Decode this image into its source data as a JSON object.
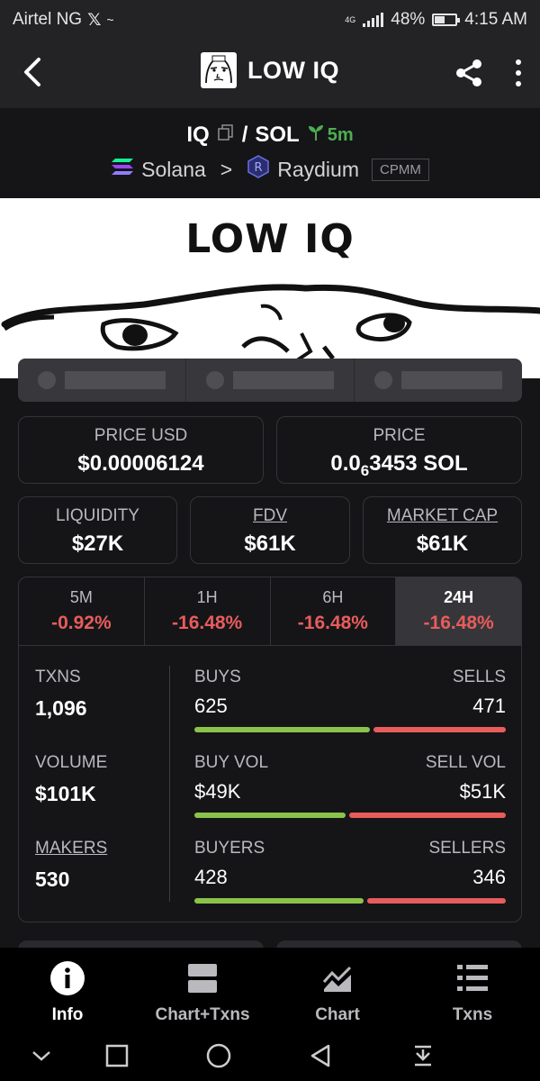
{
  "status_bar": {
    "carrier": "Airtel NG",
    "network": "4G",
    "battery": "48%",
    "time": "4:15 AM"
  },
  "app_bar": {
    "title": "LOW IQ",
    "icons": [
      "back-arrow-icon",
      "share-icon",
      "more-vertical-icon"
    ]
  },
  "pair": {
    "base": "IQ",
    "separator": "/",
    "quote": "SOL",
    "age": "5m",
    "chain": "Solana",
    "chevron": ">",
    "dex": "Raydium",
    "pool_type": "CPMM"
  },
  "banner": {
    "title": "LOW IQ"
  },
  "prices": {
    "price_usd_label": "PRICE USD",
    "price_usd": "$0.00006124",
    "price_label": "PRICE",
    "price_prefix": "0.0",
    "price_zeros": "6",
    "price_rest": "3453 SOL"
  },
  "metrics": {
    "liquidity_label": "LIQUIDITY",
    "liquidity": "$27K",
    "fdv_label": "FDV",
    "fdv": "$61K",
    "mcap_label": "MARKET CAP",
    "mcap": "$61K"
  },
  "periods": [
    {
      "label": "5M",
      "change": "-0.92%"
    },
    {
      "label": "1H",
      "change": "-16.48%"
    },
    {
      "label": "6H",
      "change": "-16.48%"
    },
    {
      "label": "24H",
      "change": "-16.48%"
    }
  ],
  "selected_period": "24H",
  "txns": {
    "txns_label": "TXNS",
    "txns": "1,096",
    "volume_label": "VOLUME",
    "volume": "$101K",
    "makers_label": "MAKERS",
    "makers": "530",
    "buys_label": "BUYS",
    "buys": "625",
    "sells_label": "SELLS",
    "sells": "471",
    "buy_vol_label": "BUY VOL",
    "buy_vol": "$49K",
    "sell_vol_label": "SELL VOL",
    "sell_vol": "$51K",
    "buyers_label": "BUYERS",
    "buyers": "428",
    "sellers_label": "SELLERS",
    "sellers": "346"
  },
  "ratios": {
    "buys_fraction": 0.57,
    "buy_vol_fraction": 0.49,
    "buyers_fraction": 0.55
  },
  "colors": {
    "positive": "#8bc34a",
    "negative": "#e85c5c",
    "age_green": "#4caf50"
  },
  "bottom_nav": [
    {
      "label": "Info",
      "icon": "info-icon"
    },
    {
      "label": "Chart+Txns",
      "icon": "split-view-icon"
    },
    {
      "label": "Chart",
      "icon": "chart-icon"
    },
    {
      "label": "Txns",
      "icon": "list-icon"
    }
  ],
  "active_tab": "Info"
}
